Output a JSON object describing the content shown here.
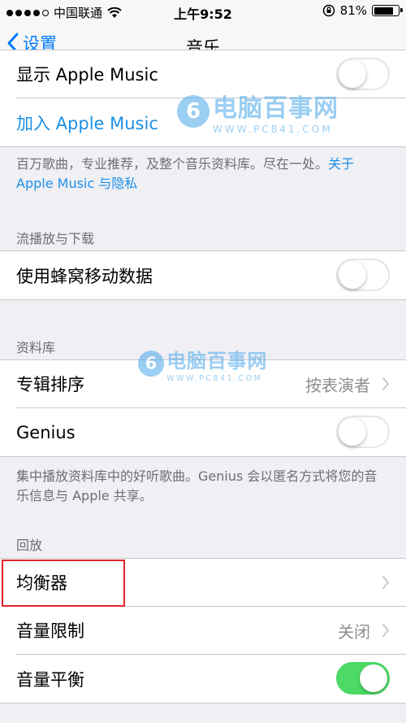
{
  "status_bar": {
    "carrier": "中国联通",
    "time": "上午9:52",
    "battery": "81%"
  },
  "nav": {
    "back_label": "设置",
    "title": "音乐"
  },
  "apple_music_group": {
    "show_label": "显示 Apple Music",
    "join_label": "加入 Apple Music"
  },
  "apple_music_footer": {
    "text": "百万歌曲，专业推荐，及整个音乐资料库。尽在一处。",
    "link": "关于 Apple Music 与隐私"
  },
  "streaming": {
    "header": "流播放与下载",
    "cellular_label": "使用蜂窝移动数据"
  },
  "library": {
    "header": "资料库",
    "sort_label": "专辑排序",
    "sort_value": "按表演者",
    "genius_label": "Genius"
  },
  "library_footer": {
    "text": "集中播放资料库中的好听歌曲。Genius 会以匿名方式将您的音乐信息与 Apple 共享。"
  },
  "playback": {
    "header": "回放",
    "eq_label": "均衡器",
    "volume_limit_label": "音量限制",
    "volume_limit_value": "关闭",
    "sound_check_label": "音量平衡"
  },
  "watermark": {
    "name": "电脑百事网",
    "site": "WWW.PC841.COM"
  },
  "colors": {
    "accent": "#007aff",
    "link": "#1e90e6",
    "toggle_on": "#4cd964",
    "highlight": "#e0242b"
  },
  "toggles": {
    "show_apple_music": false,
    "cellular": false,
    "genius": false,
    "sound_check": true
  }
}
